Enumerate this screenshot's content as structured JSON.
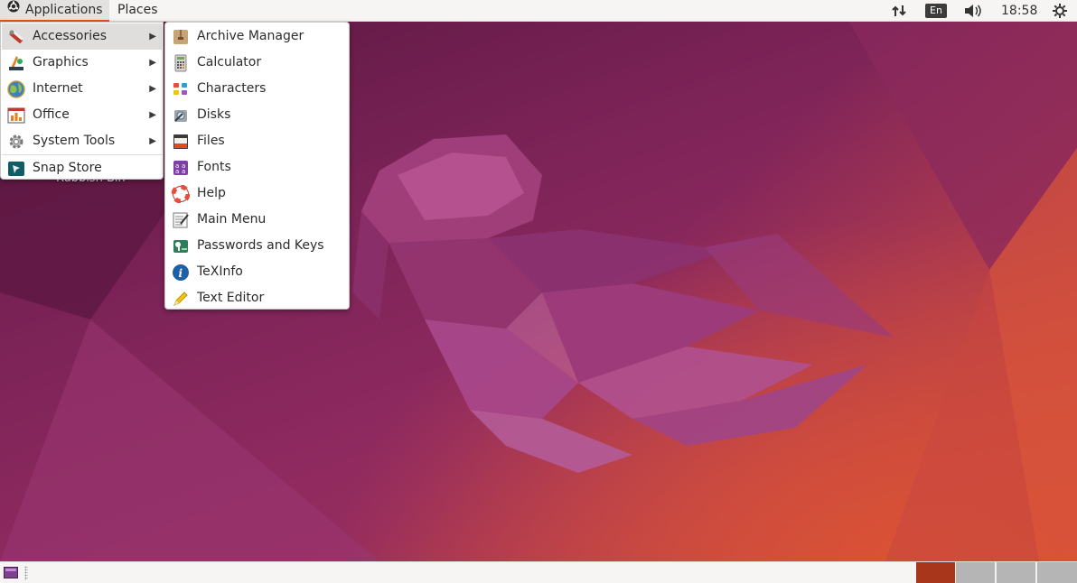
{
  "top_panel": {
    "applications_label": "Applications",
    "places_label": "Places",
    "language": "En",
    "clock": "18:58"
  },
  "desktop": {
    "icon_label_partial": "Rubbish Bin"
  },
  "applications_menu": {
    "items": [
      {
        "label": "Accessories",
        "icon": "accessories-icon",
        "has_submenu": true,
        "active": true
      },
      {
        "label": "Graphics",
        "icon": "graphics-icon",
        "has_submenu": true
      },
      {
        "label": "Internet",
        "icon": "internet-icon",
        "has_submenu": true
      },
      {
        "label": "Office",
        "icon": "office-icon",
        "has_submenu": true
      },
      {
        "label": "System Tools",
        "icon": "system-tools-icon",
        "has_submenu": true
      },
      {
        "label": "Snap Store",
        "icon": "snap-store-icon",
        "has_submenu": false
      }
    ]
  },
  "accessories_menu": {
    "items": [
      {
        "label": "Archive Manager",
        "icon": "archive-manager-icon"
      },
      {
        "label": "Calculator",
        "icon": "calculator-icon"
      },
      {
        "label": "Characters",
        "icon": "characters-icon"
      },
      {
        "label": "Disks",
        "icon": "disks-icon"
      },
      {
        "label": "Files",
        "icon": "files-icon"
      },
      {
        "label": "Fonts",
        "icon": "fonts-icon"
      },
      {
        "label": "Help",
        "icon": "help-icon"
      },
      {
        "label": "Main Menu",
        "icon": "main-menu-icon"
      },
      {
        "label": "Passwords and Keys",
        "icon": "passwords-keys-icon"
      },
      {
        "label": "TeXInfo",
        "icon": "texinfo-icon"
      },
      {
        "label": "Text Editor",
        "icon": "text-editor-icon"
      }
    ]
  },
  "colors": {
    "accent": "#e95420",
    "active_workspace": "#a8361a",
    "inactive_workspace": "#b5b5b5"
  }
}
